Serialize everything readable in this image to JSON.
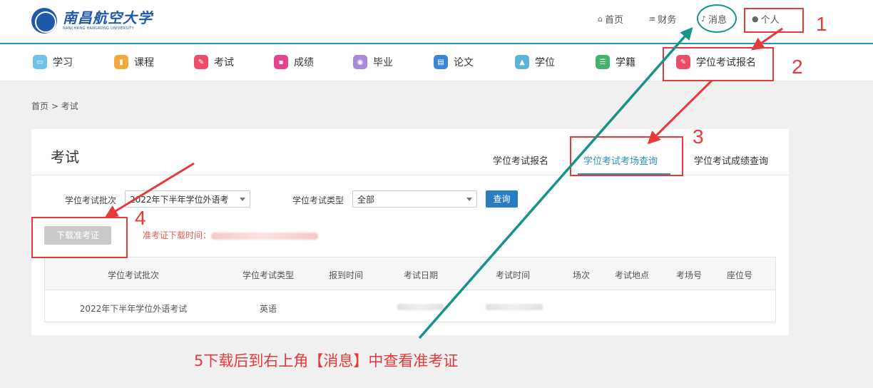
{
  "header": {
    "logo": {
      "name_cn": "南昌航空大学",
      "name_en": "NANCHANG HANGKONG UNIVERSITY"
    },
    "links": [
      {
        "label": "首页",
        "icon": "home-icon"
      },
      {
        "label": "财务",
        "icon": "database-icon"
      },
      {
        "label": "消息",
        "icon": "bell-icon"
      },
      {
        "label": "个人",
        "icon": "user-icon"
      }
    ]
  },
  "nav": {
    "items": [
      {
        "label": "学习",
        "icon": "study-icon",
        "color": "#6cc3e8"
      },
      {
        "label": "课程",
        "icon": "book-icon",
        "color": "#f2a93b"
      },
      {
        "label": "考试",
        "icon": "exam-icon",
        "color": "#ee4d6a"
      },
      {
        "label": "成绩",
        "icon": "score-icon",
        "color": "#e9428c"
      },
      {
        "label": "毕业",
        "icon": "graduation-icon",
        "color": "#a78bd8"
      },
      {
        "label": "论文",
        "icon": "paper-icon",
        "color": "#3a86d4"
      },
      {
        "label": "学位",
        "icon": "degree-cap-icon",
        "color": "#5bb3d8"
      },
      {
        "label": "学籍",
        "icon": "roster-icon",
        "color": "#45b36b"
      },
      {
        "label": "学位考试报名",
        "icon": "exam-register-icon",
        "color": "#ee4d6a"
      }
    ]
  },
  "breadcrumb": "首页 > 考试",
  "panel": {
    "title": "考试",
    "tabs": [
      "学位考试报名",
      "学位考试考场查询",
      "学位考试成绩查询"
    ],
    "filters": {
      "batch_label": "学位考试批次",
      "batch_value": "2022年下半年学位外语考",
      "type_label": "学位考试类型",
      "type_value": "全部"
    },
    "query_button": "查询",
    "download_button": "下载准考证",
    "download_time_label": "准考证下载时间："
  },
  "table": {
    "columns": [
      "学位考试批次",
      "学位考试类型",
      "报到时间",
      "考试日期",
      "考试时间",
      "场次",
      "考试地点",
      "考场号",
      "座位号"
    ],
    "rows": [
      {
        "batch": "2022年下半年学位外语考试",
        "type": "英语"
      }
    ]
  },
  "annotations": {
    "numbers": [
      "1",
      "2",
      "3",
      "4"
    ],
    "caption": "5下载后到右上角【消息】中查看准考证",
    "colors": {
      "red": "#e5393a",
      "teal": "#17948a"
    }
  }
}
